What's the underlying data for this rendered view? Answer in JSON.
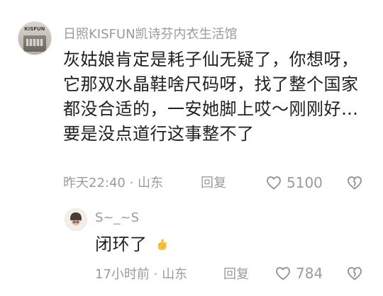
{
  "comments": [
    {
      "avatar_brand": "KISFUN",
      "username": "日照KISFUN凯诗芬内衣生活馆",
      "text": "灰姑娘肯定是耗子仙无疑了，你想呀，它那双水晶鞋啥尺码呀，找了整个国家都没合适的，一安她脚上哎～刚刚好…要是没点道行这事整不了",
      "time_location": "昨天22:40 · 山东",
      "reply_label": "回复",
      "like_count": "5100"
    },
    {
      "username": "S~_~S",
      "text": "闭环了",
      "time_location": "17小时前 · 山东",
      "reply_label": "回复",
      "like_count": "784"
    }
  ],
  "icons": {
    "like": "heart-outline-icon",
    "dislike": "broken-heart-outline-icon",
    "emoji": "ok-hand-emoji"
  },
  "colors": {
    "text": "#1f1f1f",
    "muted": "#9b9b9b",
    "icon": "#8e8e8e",
    "emoji": "#f4c542"
  }
}
